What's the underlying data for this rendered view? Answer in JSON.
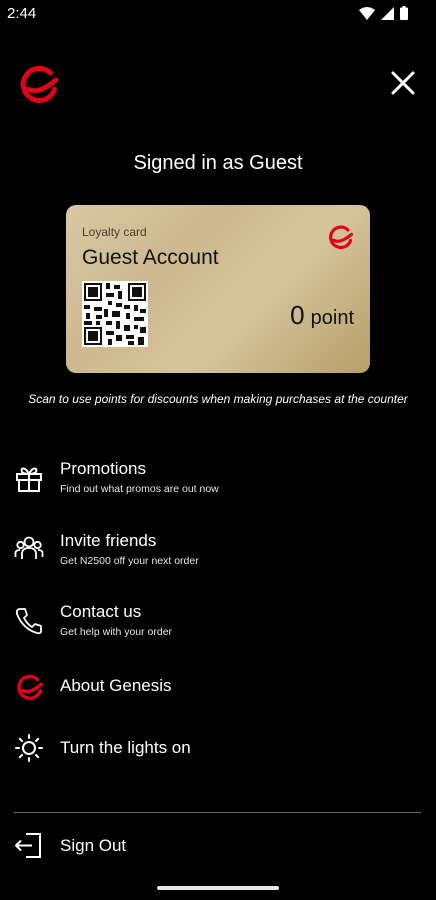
{
  "status": {
    "time": "2:44"
  },
  "header": {
    "logo_icon": "genesis-logo-icon",
    "close_icon": "close-icon"
  },
  "signed_in_text": "Signed in as Guest",
  "card": {
    "label": "Loyalty card",
    "name": "Guest Account",
    "points_value": "0",
    "points_unit": "point"
  },
  "scan_note": "Scan to use points for discounts when making purchases at the counter",
  "menu": [
    {
      "title": "Promotions",
      "subtitle": "Find out what promos are out now",
      "icon": "gift-icon"
    },
    {
      "title": "Invite friends",
      "subtitle": "Get N2500 off your next order",
      "icon": "people-icon"
    },
    {
      "title": "Contact us",
      "subtitle": "Get help with your order",
      "icon": "phone-icon"
    },
    {
      "title": "About Genesis",
      "icon": "genesis-logo-icon"
    },
    {
      "title": "Turn the lights on",
      "icon": "sun-icon"
    }
  ],
  "sign_out": {
    "label": "Sign Out",
    "icon": "sign-out-icon"
  },
  "colors": {
    "background": "#000000",
    "brand_red": "#e3001b",
    "card_gold": "#d8c8a4"
  }
}
